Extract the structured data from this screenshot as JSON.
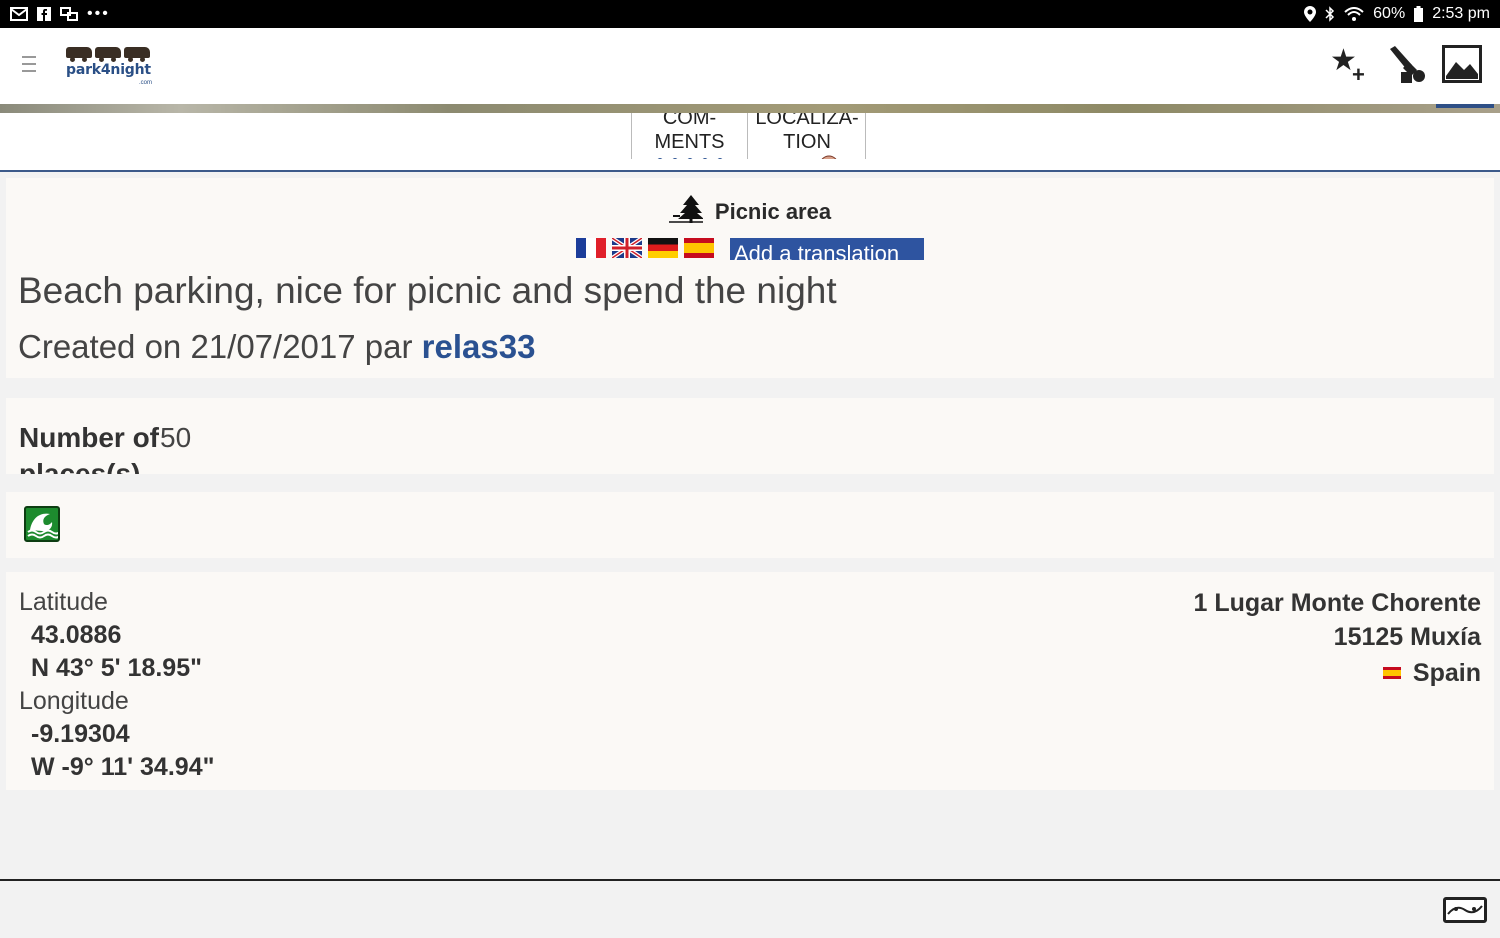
{
  "status_bar": {
    "battery": "60%",
    "time": "2:53 pm"
  },
  "app": {
    "logo_text": "park4night",
    "logo_domain": ".com"
  },
  "tabs": [
    {
      "line1": "COM-",
      "line2": "MENTS"
    },
    {
      "line1": "LOCALIZA-",
      "line2": "TION"
    }
  ],
  "place": {
    "type": "Picnic area",
    "translate_label": "Add a translation",
    "description": "Beach parking, nice for picnic and spend the night",
    "created_prefix": "Created on 21/07/2017 par",
    "author": "relas33"
  },
  "places": {
    "label": "Number of places(s)",
    "value": "50"
  },
  "location": {
    "latitude_label": "Latitude",
    "latitude": "43.0886",
    "latitude_dms": "N 43° 5' 18.95\"",
    "longitude_label": "Longitude",
    "longitude": "-9.19304",
    "longitude_dms": "W -9° 11' 34.94\"",
    "address_line1": "1 Lugar Monte Chorente",
    "address_line2": "15125 Muxía",
    "country": "Spain"
  },
  "icons": {
    "menu": "menu-icon",
    "favorite": "star-plus-icon",
    "edit": "brush-icon",
    "photo": "image-icon",
    "place_type": "tree-picnic-icon",
    "service": "beach-wave-icon",
    "map": "map-icon"
  }
}
